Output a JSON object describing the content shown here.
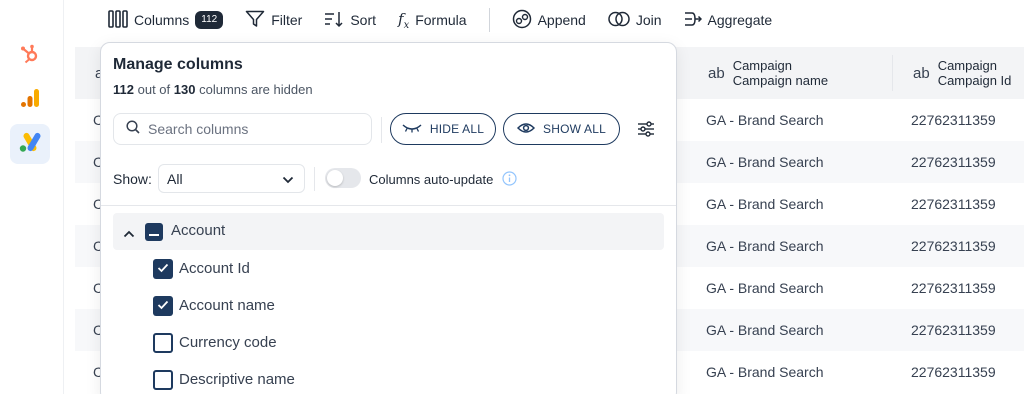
{
  "toolbar": {
    "columns_label": "Columns",
    "columns_badge": "112",
    "filter_label": "Filter",
    "sort_label": "Sort",
    "formula_label": "Formula",
    "append_label": "Append",
    "join_label": "Join",
    "aggregate_label": "Aggregate"
  },
  "rail": {
    "items": [
      {
        "icon": "hubspot-icon",
        "color": "#ff7a59"
      },
      {
        "icon": "google-analytics-icon",
        "color": "#f9ab00"
      },
      {
        "icon": "google-ads-icon",
        "color": "#4285f4",
        "active": true
      }
    ]
  },
  "table": {
    "headers": [
      {
        "type": "ab",
        "line1": "Campaign",
        "line2": "Campaign name"
      },
      {
        "type": "ab",
        "line1": "Campaign",
        "line2": "Campaign Id"
      }
    ],
    "rows": [
      {
        "first": "C",
        "name": "GA - Brand Search",
        "id": "22762311359"
      },
      {
        "first": "C",
        "name": "GA - Brand Search",
        "id": "22762311359"
      },
      {
        "first": "C",
        "name": "GA - Brand Search",
        "id": "22762311359"
      },
      {
        "first": "C",
        "name": "GA - Brand Search",
        "id": "22762311359"
      },
      {
        "first": "C",
        "name": "GA - Brand Search",
        "id": "22762311359"
      },
      {
        "first": "C",
        "name": "GA - Brand Search",
        "id": "22762311359"
      },
      {
        "first": "C",
        "name": "GA - Brand Search",
        "id": "22762311359"
      }
    ],
    "first_header_partial": "a"
  },
  "modal": {
    "title": "Manage columns",
    "hidden_count": "112",
    "sub_mid": "out of",
    "total_count": "130",
    "sub_end": "columns are hidden",
    "search_placeholder": "Search columns",
    "hide_all": "HIDE ALL",
    "show_all": "SHOW ALL",
    "show_label": "Show:",
    "show_value": "All",
    "auto_update_label": "Columns auto-update",
    "auto_update_on": false,
    "group": {
      "label": "Account",
      "state": "partial",
      "items": [
        {
          "label": "Account Id",
          "checked": true
        },
        {
          "label": "Account name",
          "checked": true
        },
        {
          "label": "Currency code",
          "checked": false
        },
        {
          "label": "Descriptive name",
          "checked": false
        }
      ]
    }
  },
  "colors": {
    "accent": "#1e3a5f",
    "header_bg": "#f3f4f6"
  }
}
